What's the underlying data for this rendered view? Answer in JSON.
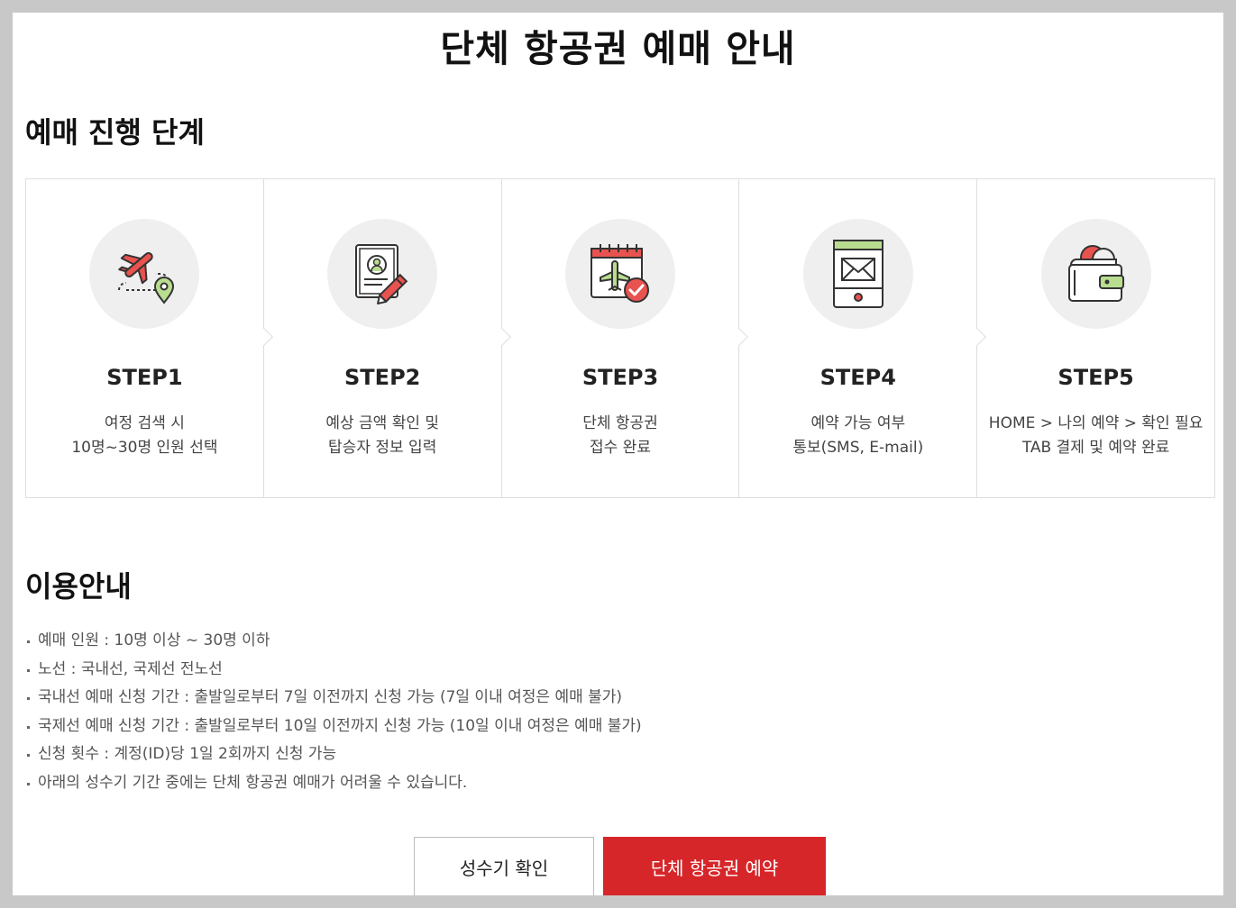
{
  "page_title": "단체 항공권 예매 안내",
  "steps_section": {
    "title": "예매 진행 단계",
    "steps": [
      {
        "label": "STEP1",
        "desc": [
          "여정 검색 시",
          "10명~30명 인원 선택"
        ],
        "icon": "plane-route-icon"
      },
      {
        "label": "STEP2",
        "desc": [
          "예상 금액 확인 및",
          "탑승자 정보 입력"
        ],
        "icon": "profile-form-pencil-icon"
      },
      {
        "label": "STEP3",
        "desc": [
          "단체 항공권",
          "접수 완료"
        ],
        "icon": "calendar-plane-check-icon"
      },
      {
        "label": "STEP4",
        "desc": [
          "예약 가능 여부",
          "통보(SMS, E-mail)"
        ],
        "icon": "mobile-envelope-icon"
      },
      {
        "label": "STEP5",
        "desc": [
          "HOME > 나의 예약 > 확인 필요",
          "TAB 결제 및 예약 완료"
        ],
        "icon": "wallet-coin-icon"
      }
    ]
  },
  "info_section": {
    "title": "이용안내",
    "items": [
      "예매 인원 : 10명 이상 ~ 30명 이하",
      "노선 : 국내선, 국제선 전노선",
      "국내선 예매 신청 기간 : 출발일로부터 7일 이전까지 신청 가능 (7일 이내 여정은 예매 불가)",
      "국제선 예매 신청 기간 : 출발일로부터 10일 이전까지 신청 가능 (10일 이내 여정은 예매 불가)",
      "신청 횟수 : 계정(ID)당 1일 2회까지 신청 가능",
      "아래의 성수기 기간 중에는 단체 항공권 예매가 어려울 수 있습니다."
    ]
  },
  "buttons": {
    "peak_season": "성수기 확인",
    "group_booking": "단체 항공권 예약"
  },
  "colors": {
    "accent_red": "#d6262a",
    "icon_red": "#e8534f",
    "icon_green": "#b9dd8f",
    "circle_bg": "#efefef"
  }
}
